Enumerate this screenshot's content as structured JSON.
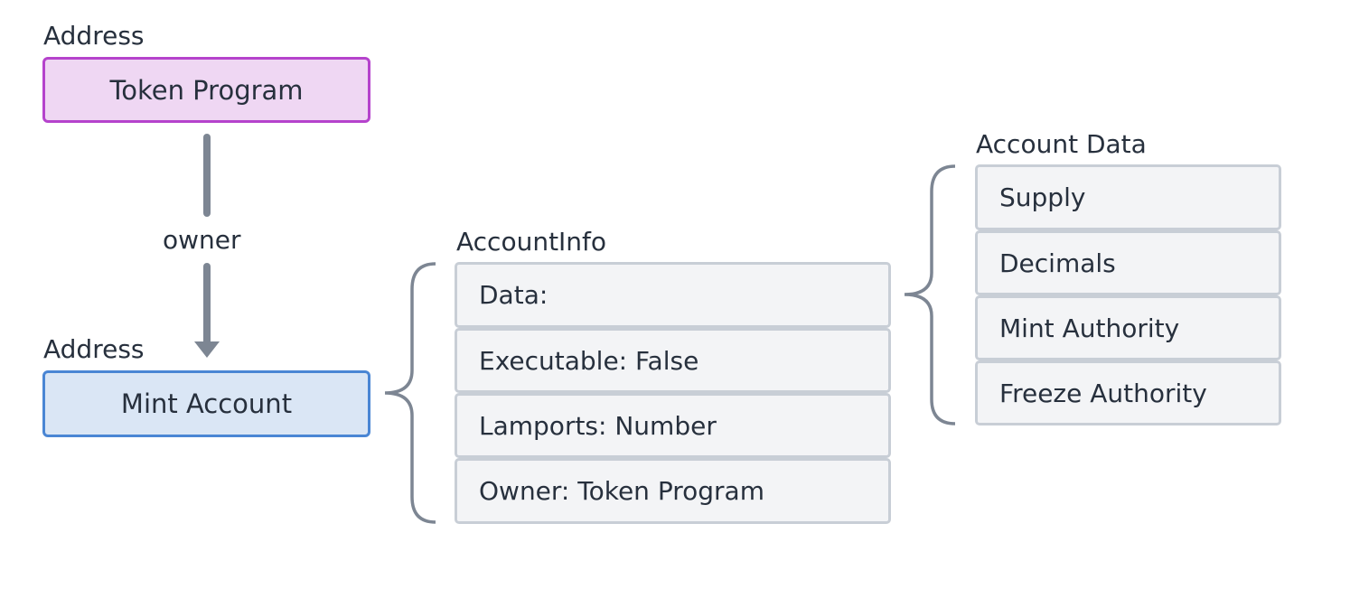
{
  "colors": {
    "program_border": "#b543cc",
    "program_fill": "#efd7f3",
    "account_border": "#4a86d4",
    "account_fill": "#dae6f5",
    "row_border": "#c8ced6",
    "row_fill": "#f3f4f6",
    "connector": "#7d8693"
  },
  "program": {
    "caption": "Address",
    "label": "Token Program"
  },
  "edge": {
    "label": "owner"
  },
  "account": {
    "caption": "Address",
    "label": "Mint Account"
  },
  "account_info": {
    "title": "AccountInfo",
    "fields": [
      "Data:",
      "Executable: False",
      "Lamports: Number",
      "Owner: Token Program"
    ]
  },
  "account_data": {
    "title": "Account Data",
    "fields": [
      "Supply",
      "Decimals",
      "Mint Authority",
      "Freeze Authority"
    ]
  }
}
